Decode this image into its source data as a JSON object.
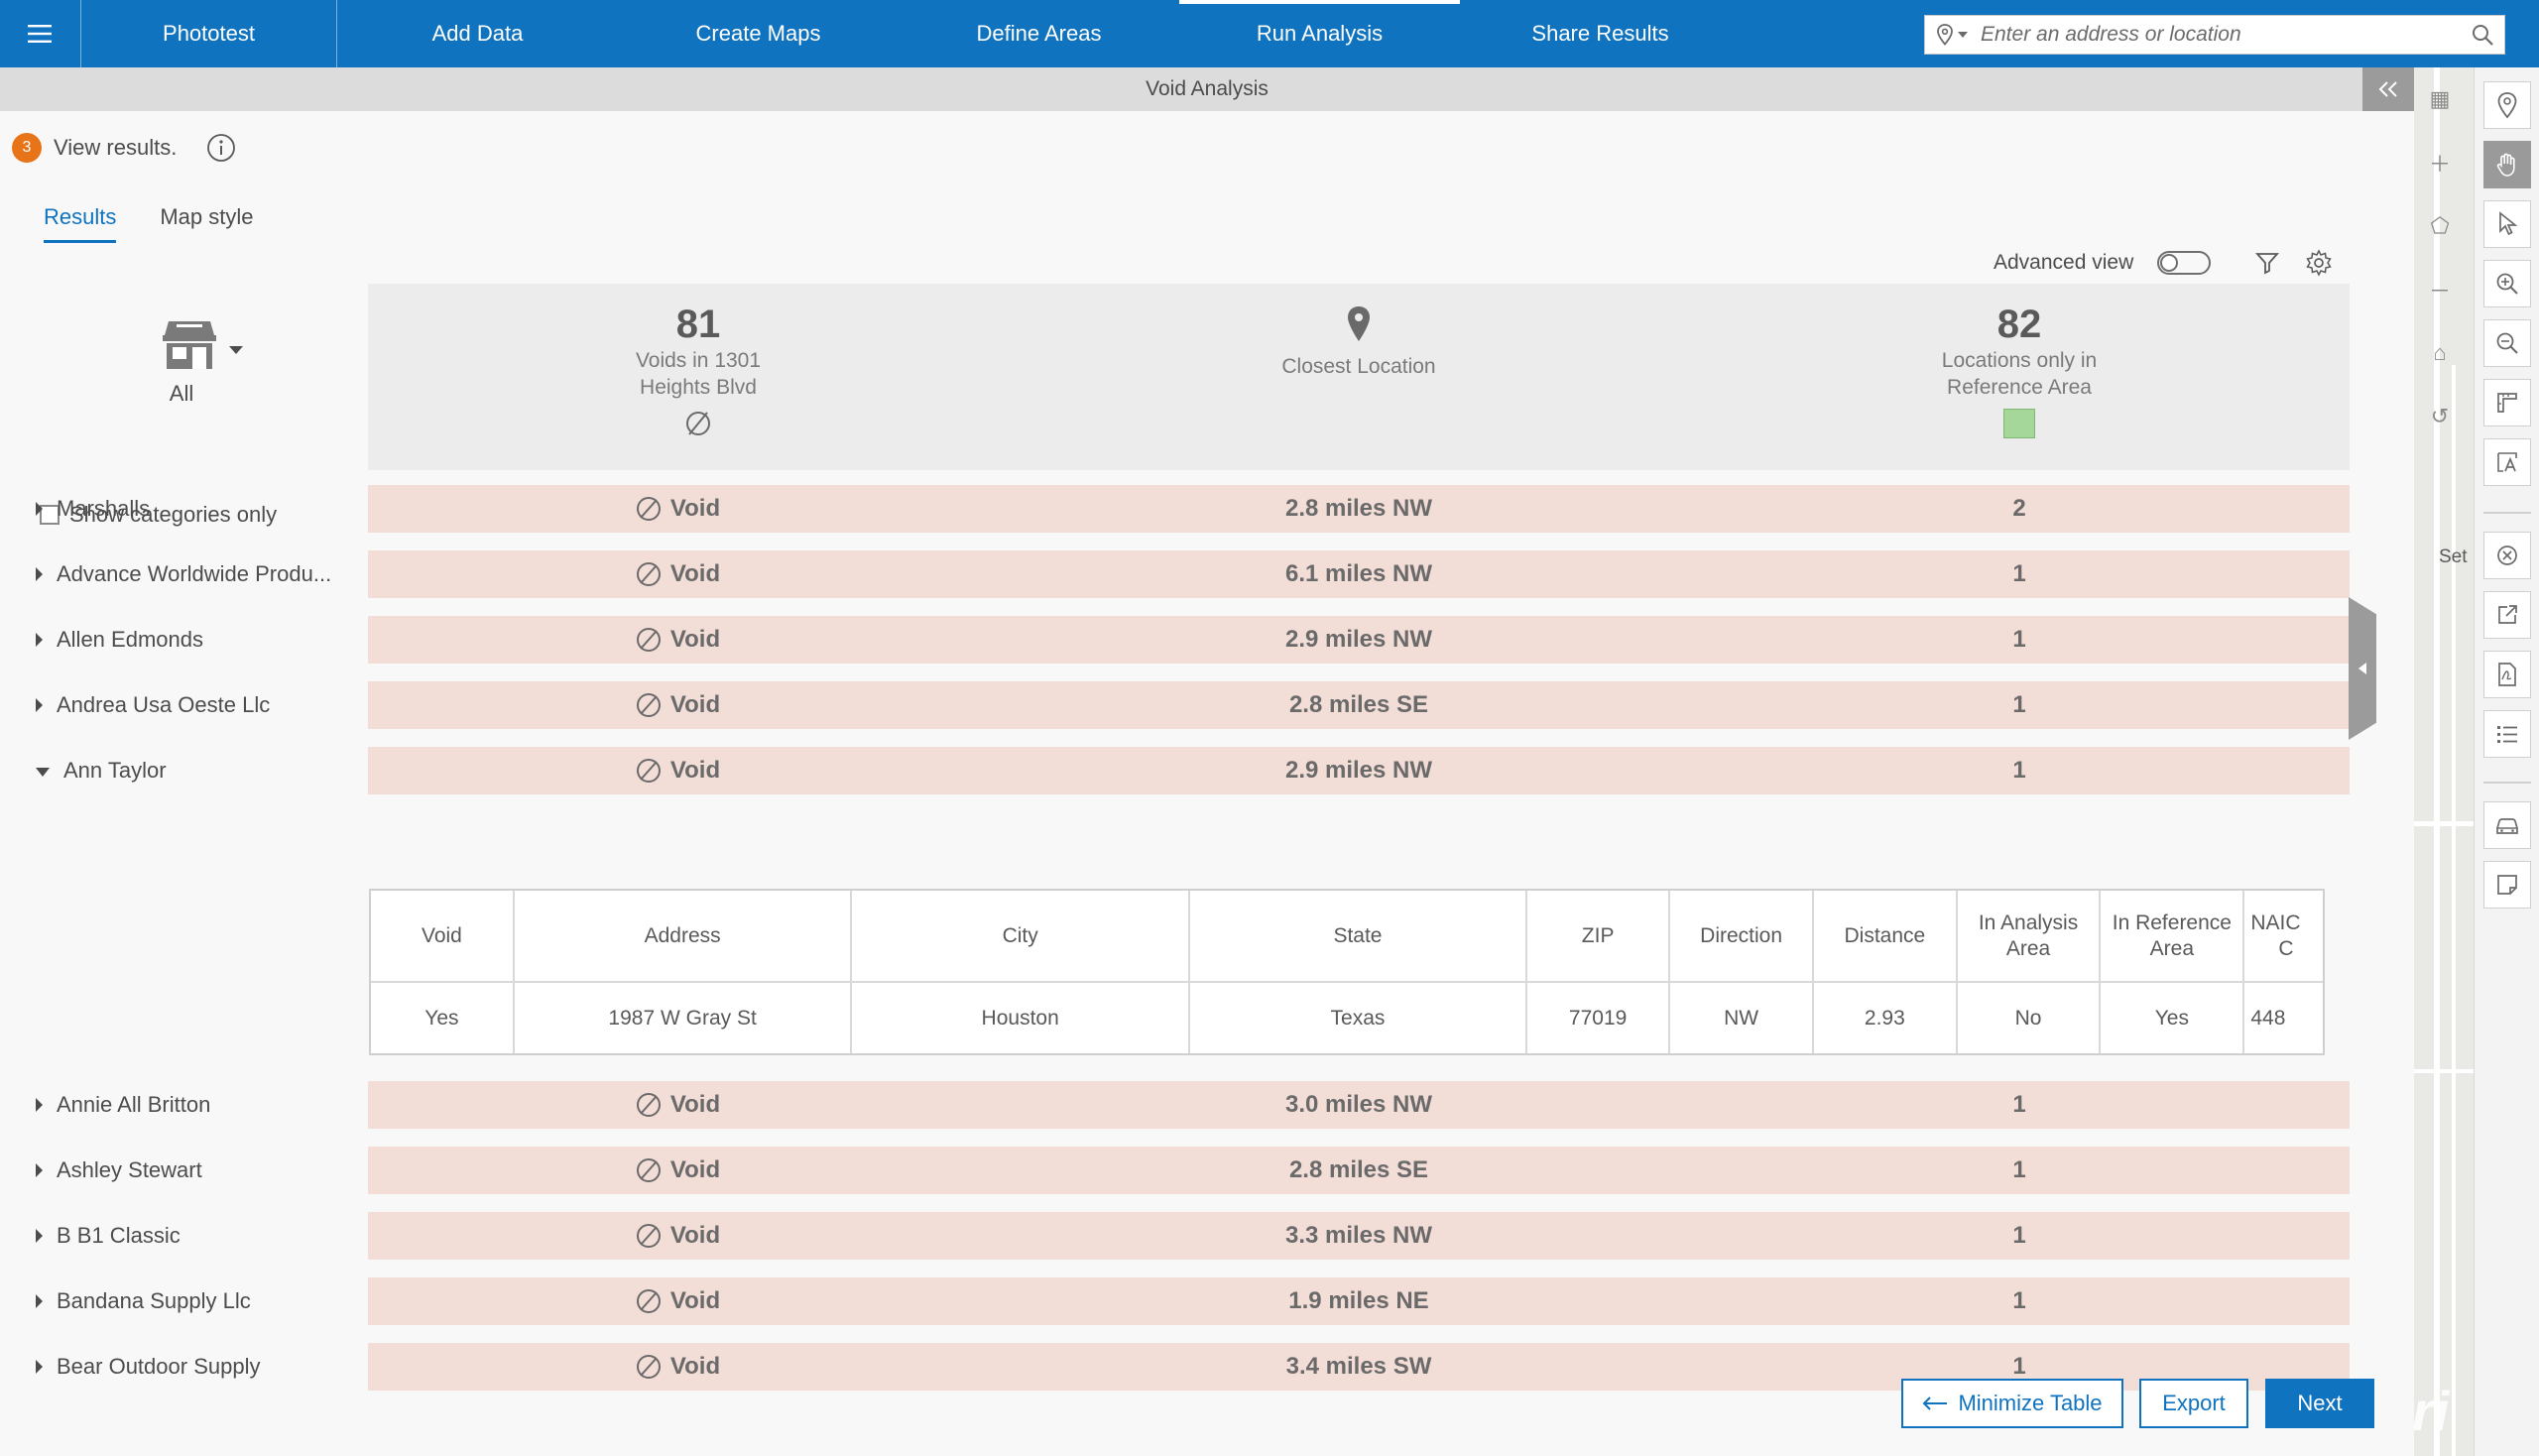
{
  "app": {
    "title": "Phototest",
    "nav_tabs": [
      "Add Data",
      "Create Maps",
      "Define Areas",
      "Run Analysis",
      "Share Results"
    ],
    "active_tab": "Run Analysis"
  },
  "search": {
    "placeholder": "Enter an address or location"
  },
  "panel": {
    "title": "Void Analysis",
    "step_number": "3",
    "step_text": "View results.",
    "tabs": [
      "Results",
      "Map style"
    ],
    "advanced_view_label": "Advanced view",
    "advanced_view_on": false
  },
  "category": {
    "label": "All",
    "show_categories_only": "Show categories only"
  },
  "summary": {
    "voids_count": "81",
    "voids_desc_1": "Voids in 1301",
    "voids_desc_2": "Heights Blvd",
    "closest_desc": "Closest Location",
    "ref_count": "82",
    "ref_desc_1": "Locations only in",
    "ref_desc_2": "Reference Area",
    "ref_swatch_color": "#a6d79a"
  },
  "rows": [
    {
      "name": "Marshalls",
      "status": "Void",
      "closest": "2.8 miles NW",
      "count": "2"
    },
    {
      "name": "Advance Worldwide Produ...",
      "status": "Void",
      "closest": "6.1 miles NW",
      "count": "1"
    },
    {
      "name": "Allen Edmonds",
      "status": "Void",
      "closest": "2.9 miles NW",
      "count": "1"
    },
    {
      "name": "Andrea Usa Oeste Llc",
      "status": "Void",
      "closest": "2.8 miles SE",
      "count": "1"
    },
    {
      "name": "Ann Taylor",
      "status": "Void",
      "closest": "2.9 miles NW",
      "count": "1"
    },
    {
      "name": "Annie All Britton",
      "status": "Void",
      "closest": "3.0 miles NW",
      "count": "1"
    },
    {
      "name": "Ashley Stewart",
      "status": "Void",
      "closest": "2.8 miles SE",
      "count": "1"
    },
    {
      "name": "B B1 Classic",
      "status": "Void",
      "closest": "3.3 miles NW",
      "count": "1"
    },
    {
      "name": "Bandana Supply Llc",
      "status": "Void",
      "closest": "1.9 miles NE",
      "count": "1"
    },
    {
      "name": "Bear Outdoor Supply",
      "status": "Void",
      "closest": "3.4 miles SW",
      "count": "1"
    }
  ],
  "detail": {
    "headers": [
      "Void",
      "Address",
      "City",
      "State",
      "ZIP",
      "Direction",
      "Distance",
      "In Analysis Area",
      "In Reference Area",
      "NAICS C"
    ],
    "header_naics_line1": "NAIC",
    "header_naics_line2": "C",
    "row": [
      "Yes",
      "1987 W Gray St",
      "Houston",
      "Texas",
      "77019",
      "NW",
      "2.93",
      "No",
      "Yes",
      "448"
    ]
  },
  "map": {
    "side_label": "Set"
  },
  "buttons": {
    "minimize": "Minimize Table",
    "export": "Export",
    "next": "Next"
  },
  "colors": {
    "brand": "#0f73bf",
    "void_row": "#f3ddd7",
    "step_badge": "#e8741a"
  }
}
